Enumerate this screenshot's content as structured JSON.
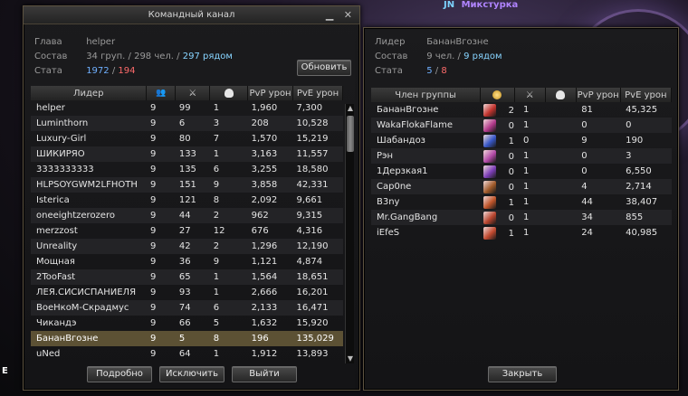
{
  "background": {
    "player_tag": "JN",
    "player_name": "Микстурка"
  },
  "command_channel": {
    "title": "Командный канал",
    "leader_label": "Глава",
    "leader": "helper",
    "composition_label": "Состав",
    "groups": "34 груп.",
    "people": "298 чел.",
    "nearby": "297 рядом",
    "stats_label": "Стата",
    "stat_blue": "1972",
    "stat_red": "194",
    "refresh_button": "Обновить",
    "columns": {
      "leader": "Лидер",
      "pvp": "PvP урон",
      "pve": "PvE урон"
    },
    "rows": [
      {
        "name": "helper",
        "members": "9",
        "kills": "99",
        "deaths": "1",
        "pvp": "1,960",
        "pve": "7,300"
      },
      {
        "name": "Luminthorn",
        "members": "9",
        "kills": "6",
        "deaths": "3",
        "pvp": "208",
        "pve": "10,528"
      },
      {
        "name": "Luxury-Girl",
        "members": "9",
        "kills": "80",
        "deaths": "7",
        "pvp": "1,570",
        "pve": "15,219"
      },
      {
        "name": "ШИКИРЯО",
        "members": "9",
        "kills": "133",
        "deaths": "1",
        "pvp": "3,163",
        "pve": "11,557"
      },
      {
        "name": "3333333333",
        "members": "9",
        "kills": "135",
        "deaths": "6",
        "pvp": "3,255",
        "pve": "18,580"
      },
      {
        "name": "HLPSOYGWM2LFHOTH",
        "members": "9",
        "kills": "151",
        "deaths": "9",
        "pvp": "3,858",
        "pve": "42,331"
      },
      {
        "name": "Isterica",
        "members": "9",
        "kills": "121",
        "deaths": "8",
        "pvp": "2,092",
        "pve": "9,661"
      },
      {
        "name": "oneeightzerozero",
        "members": "9",
        "kills": "44",
        "deaths": "2",
        "pvp": "962",
        "pve": "9,315"
      },
      {
        "name": "merzzost",
        "members": "9",
        "kills": "27",
        "deaths": "12",
        "pvp": "676",
        "pve": "4,316"
      },
      {
        "name": "Unreality",
        "members": "9",
        "kills": "42",
        "deaths": "2",
        "pvp": "1,296",
        "pve": "12,190"
      },
      {
        "name": "Мощная",
        "members": "9",
        "kills": "36",
        "deaths": "9",
        "pvp": "1,121",
        "pve": "4,874"
      },
      {
        "name": "2TooFast",
        "members": "9",
        "kills": "65",
        "deaths": "1",
        "pvp": "1,564",
        "pve": "18,651"
      },
      {
        "name": "ЛЕЯ.СИСИСПАНИЕЛЯ",
        "members": "9",
        "kills": "93",
        "deaths": "1",
        "pvp": "2,666",
        "pve": "16,201"
      },
      {
        "name": "ВоеНкоМ-Скрадмус",
        "members": "9",
        "kills": "74",
        "deaths": "6",
        "pvp": "2,133",
        "pve": "16,471"
      },
      {
        "name": "Чикандэ",
        "members": "9",
        "kills": "66",
        "deaths": "5",
        "pvp": "1,632",
        "pve": "15,920"
      },
      {
        "name": "БананВгознe",
        "members": "9",
        "kills": "5",
        "deaths": "8",
        "pvp": "196",
        "pve": "135,029"
      },
      {
        "name": "uNed",
        "members": "9",
        "kills": "64",
        "deaths": "1",
        "pvp": "1,912",
        "pve": "13,893"
      }
    ],
    "buttons": {
      "details": "Подробно",
      "exclude": "Исключить",
      "leave": "Выйти"
    }
  },
  "group": {
    "leader_label": "Лидер",
    "leader": "БананВгознe",
    "composition_label": "Состав",
    "people": "9 чел.",
    "nearby": "9 рядом",
    "stats_label": "Стата",
    "stat_blue": "5",
    "stat_red": "8",
    "columns": {
      "member": "Член группы",
      "pvp": "PvP урон",
      "pve": "PvE урон"
    },
    "rows": [
      {
        "name": "БананВгознe",
        "c1": "2",
        "c2": "1",
        "c3": "81",
        "pve": "45,325",
        "color": "#c2342e"
      },
      {
        "name": "WakaFlokaFlame",
        "c1": "0",
        "c2": "1",
        "c3": "0",
        "pve": "0",
        "color": "#b33a8c"
      },
      {
        "name": "Шабандоз",
        "c1": "1",
        "c2": "0",
        "c3": "9",
        "pve": "190",
        "color": "#3858c8"
      },
      {
        "name": "Рэн",
        "c1": "0",
        "c2": "1",
        "c3": "0",
        "pve": "3",
        "color": "#b34aa8"
      },
      {
        "name": "1Дерзкая1",
        "c1": "0",
        "c2": "1",
        "c3": "0",
        "pve": "6,550",
        "color": "#7d3fb8"
      },
      {
        "name": "Cap0ne",
        "c1": "0",
        "c2": "1",
        "c3": "4",
        "pve": "2,714",
        "color": "#a05a2a"
      },
      {
        "name": "B3ny",
        "c1": "1",
        "c2": "1",
        "c3": "44",
        "pve": "38,407",
        "color": "#c0552a"
      },
      {
        "name": "Mr.GangBang",
        "c1": "0",
        "c2": "1",
        "c3": "34",
        "pve": "855",
        "color": "#b8452e"
      },
      {
        "name": "iEfeS",
        "c1": "1",
        "c2": "1",
        "c3": "24",
        "pve": "40,985",
        "color": "#c24a30"
      }
    ],
    "close_button": "Закрыть"
  }
}
